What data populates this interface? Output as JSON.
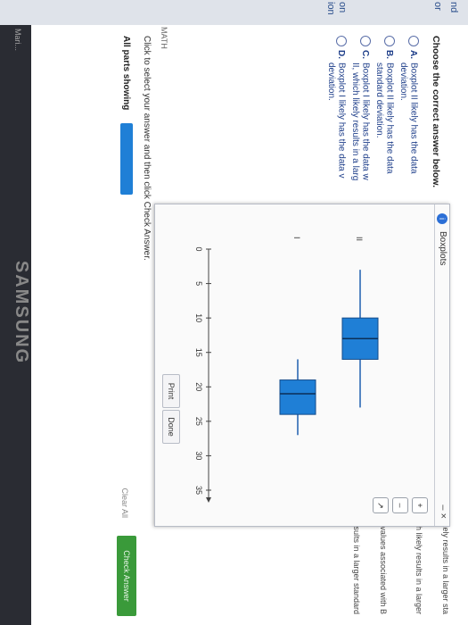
{
  "question": {
    "prompt": "Choose the correct answer below."
  },
  "options": [
    {
      "letter": "A.",
      "line1": "Boxplot II likely has the data",
      "line2": "deviation."
    },
    {
      "letter": "B.",
      "line1": "Boxplot II likely has the data",
      "line2": "standard deviation."
    },
    {
      "letter": "C.",
      "line1": "Boxplot I likely has the data w",
      "line2": "II, which likely results in a larg"
    },
    {
      "letter": "D.",
      "line1": "Boxplot I likely has the data v",
      "line2": "deviation."
    }
  ],
  "right_fragments": [
    "h likely results in a larger sta",
    "ich likely results in a larger",
    "the values associated with B",
    "y results in a larger standard"
  ],
  "left_fragments": [
    "nd",
    "or",
    "on",
    "ion"
  ],
  "status": {
    "instruction": "Click to select your answer and then click Check Answer.",
    "parts": "All parts showing"
  },
  "buttons": {
    "clear_all": "Clear All",
    "check_answer": "Check Answer",
    "print": "Print",
    "done": "Done"
  },
  "footer_left": "MATH",
  "taskbar_label": "Mari...",
  "modal": {
    "title": "Boxplots",
    "controls": "– ×",
    "info_glyph": "i",
    "tool_zoom_in": "+",
    "tool_zoom_out": "–",
    "tool_external": "↗"
  },
  "chart_data": {
    "type": "boxplot",
    "axis": {
      "min": 0,
      "max": 35,
      "ticks": [
        0,
        5,
        10,
        15,
        20,
        25,
        30,
        35
      ]
    },
    "series": [
      {
        "name": "I",
        "min": 16,
        "q1": 19,
        "median": 21,
        "q3": 24,
        "max": 27
      },
      {
        "name": "II",
        "min": 3,
        "q1": 10,
        "median": 13,
        "q3": 16,
        "max": 23
      }
    ],
    "colors": {
      "box": "#1f7fd6",
      "line": "#1f5fb0"
    }
  },
  "brand": "SAMSUNG"
}
